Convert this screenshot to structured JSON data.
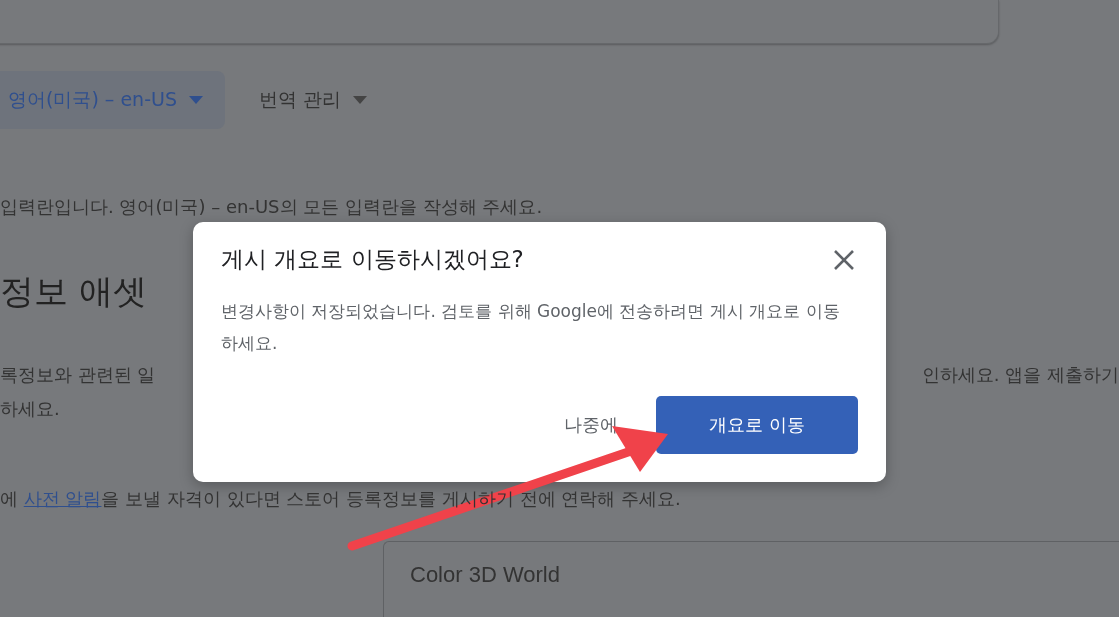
{
  "toolbar": {
    "language": "영어(미국) – en-US",
    "translate": "번역 관리"
  },
  "notice": "입력란입니다. 영어(미국) – en-US의 모든 입력란을 작성해 주세요.",
  "section": {
    "heading": "정보 애셋",
    "desc_left": "록정보와 관련된 일",
    "desc_right": "인하세요. 앱을 제출하기",
    "desc_line2": "하세요.",
    "alert_before": "에 ",
    "alert_link": "사전 알림",
    "alert_after": "을 보낼 자격이 있다면 스토어 등록정보를 게시하기 전에 연락해 주세요."
  },
  "app_name_field": {
    "value": "Color 3D World"
  },
  "dialog": {
    "title": "게시 개요로 이동하시겠어요?",
    "body": "변경사항이 저장되었습니다. 검토를 위해 Google에 전송하려면 게시 개요로 이동하세요.",
    "buttons": [
      {
        "label": "나중에",
        "kind": "text"
      },
      {
        "label": "개요로 이동",
        "kind": "primary"
      }
    ]
  }
}
